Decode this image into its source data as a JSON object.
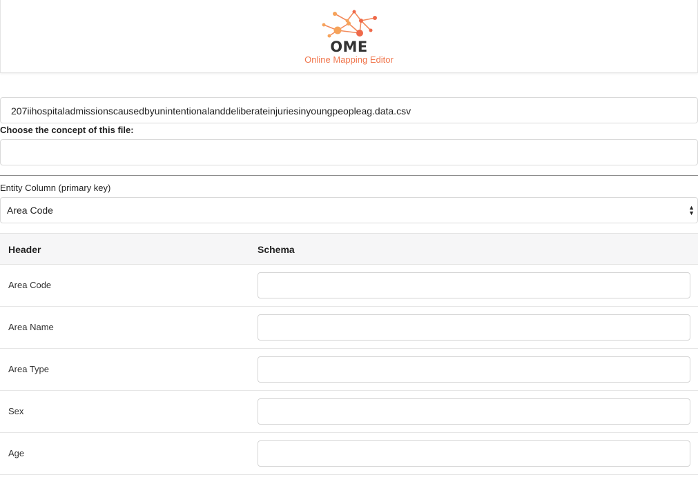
{
  "header": {
    "logo_icon": "network-graph-logo-icon",
    "brand_name": "OME",
    "brand_subtitle": "Online Mapping Editor",
    "accent_color": "#f0774e"
  },
  "file": {
    "name": "207iihospitaladmissionscausedbyunintentionalanddeliberateinjuriesinyoungpeopleag.data.csv"
  },
  "concept": {
    "label": "Choose the concept of this file:",
    "value": ""
  },
  "entity": {
    "label": "Entity Column (primary key)",
    "selected": "Area Code"
  },
  "table": {
    "headers": {
      "header": "Header",
      "schema": "Schema"
    },
    "rows": [
      {
        "label": "Area Code",
        "schema": ""
      },
      {
        "label": "Area Name",
        "schema": ""
      },
      {
        "label": "Area Type",
        "schema": ""
      },
      {
        "label": "Sex",
        "schema": ""
      },
      {
        "label": "Age",
        "schema": ""
      }
    ]
  }
}
